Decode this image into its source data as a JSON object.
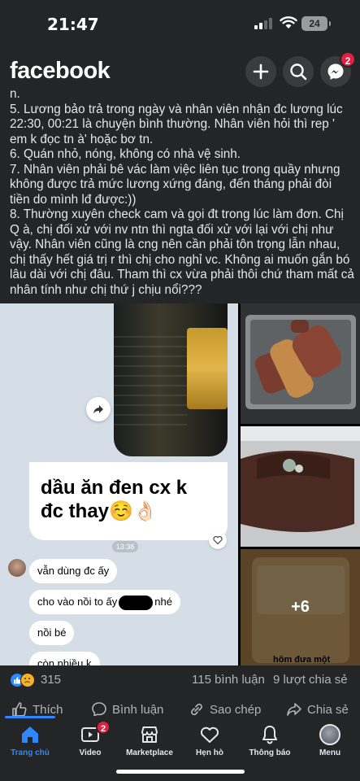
{
  "status_bar": {
    "time": "21:47",
    "battery": "24"
  },
  "header": {
    "logo": "facebook",
    "messenger_badge": "2",
    "icons": [
      "plus-icon",
      "search-icon",
      "messenger-icon"
    ]
  },
  "post": {
    "paragraphs": [
      "n.",
      "5. Lương bảo trả trong ngày và nhân viên nhận đc lương lúc 22:30, 00:21 là chuyện bình thường. Nhân viên hỏi thì rep ' em k đọc tn à' hoặc bơ tn.",
      "6. Quán nhỏ, nóng, không có nhà vệ sinh.",
      "7. Nhân viên phải bê vác làm việc liên tục trong quầy nhưng không được trả mức lương xứng đáng, đến tháng phải đòi tiền do mình lđ được:))",
      "8. Thường xuyên check cam và gọi đt trong lúc làm đơn. Chị Q à, chị đối xử với nv ntn thì ngta đối xử với lại với chị như vậy. Nhân viên cũng là cng nên cần phải tôn trọng lẫn nhau, chị thấy hết giá trị r thì chị cho nghỉ vc. Không ai muốn gắn bó lâu dài với chị đâu. Tham thì cx vừa phải thôi chứ tham mất cả nhân tính như chị thứ j chịu nổi???"
    ]
  },
  "images": {
    "main": {
      "caption_line1": "dầu ăn đen cx k",
      "caption_line2": "đc thay☺️👌🏻",
      "timestamp": "13:38",
      "messages": [
        "vẫn dùng đc ấy",
        "cho vào nồi to ấy",
        "nhé",
        "nồi bé",
        "còn nhiều k"
      ]
    },
    "more_count": "+6",
    "thumb3_text": "hôm đưa một"
  },
  "reactions": {
    "count": "315",
    "comments": "115 bình luận",
    "shares": "9 lượt chia sẻ"
  },
  "actions": {
    "like": "Thích",
    "comment": "Bình luận",
    "copy": "Sao chép",
    "share": "Chia sẻ"
  },
  "tabs": [
    {
      "label": "Trang chủ"
    },
    {
      "label": "Video",
      "badge": "2"
    },
    {
      "label": "Marketplace"
    },
    {
      "label": "Hẹn hò"
    },
    {
      "label": "Thông báo"
    },
    {
      "label": "Menu"
    }
  ],
  "colors": {
    "background": "#242526",
    "accent": "#2d88ff",
    "badge": "#e41e3f",
    "text": "#e4e6eb",
    "muted": "#b0b3b8"
  }
}
